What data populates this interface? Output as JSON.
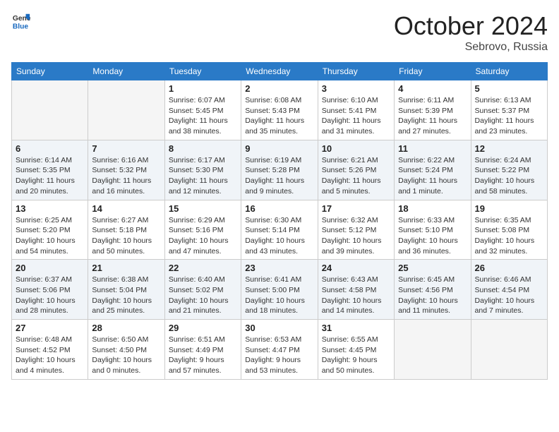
{
  "header": {
    "logo": {
      "general": "General",
      "blue": "Blue"
    },
    "month": "October 2024",
    "location": "Sebrovo, Russia"
  },
  "weekdays": [
    "Sunday",
    "Monday",
    "Tuesday",
    "Wednesday",
    "Thursday",
    "Friday",
    "Saturday"
  ],
  "weeks": [
    [
      {
        "day": "",
        "sunrise": "",
        "sunset": "",
        "daylight": "",
        "empty": true
      },
      {
        "day": "",
        "sunrise": "",
        "sunset": "",
        "daylight": "",
        "empty": true
      },
      {
        "day": "1",
        "sunrise": "Sunrise: 6:07 AM",
        "sunset": "Sunset: 5:45 PM",
        "daylight": "Daylight: 11 hours and 38 minutes.",
        "empty": false
      },
      {
        "day": "2",
        "sunrise": "Sunrise: 6:08 AM",
        "sunset": "Sunset: 5:43 PM",
        "daylight": "Daylight: 11 hours and 35 minutes.",
        "empty": false
      },
      {
        "day": "3",
        "sunrise": "Sunrise: 6:10 AM",
        "sunset": "Sunset: 5:41 PM",
        "daylight": "Daylight: 11 hours and 31 minutes.",
        "empty": false
      },
      {
        "day": "4",
        "sunrise": "Sunrise: 6:11 AM",
        "sunset": "Sunset: 5:39 PM",
        "daylight": "Daylight: 11 hours and 27 minutes.",
        "empty": false
      },
      {
        "day": "5",
        "sunrise": "Sunrise: 6:13 AM",
        "sunset": "Sunset: 5:37 PM",
        "daylight": "Daylight: 11 hours and 23 minutes.",
        "empty": false
      }
    ],
    [
      {
        "day": "6",
        "sunrise": "Sunrise: 6:14 AM",
        "sunset": "Sunset: 5:35 PM",
        "daylight": "Daylight: 11 hours and 20 minutes.",
        "empty": false
      },
      {
        "day": "7",
        "sunrise": "Sunrise: 6:16 AM",
        "sunset": "Sunset: 5:32 PM",
        "daylight": "Daylight: 11 hours and 16 minutes.",
        "empty": false
      },
      {
        "day": "8",
        "sunrise": "Sunrise: 6:17 AM",
        "sunset": "Sunset: 5:30 PM",
        "daylight": "Daylight: 11 hours and 12 minutes.",
        "empty": false
      },
      {
        "day": "9",
        "sunrise": "Sunrise: 6:19 AM",
        "sunset": "Sunset: 5:28 PM",
        "daylight": "Daylight: 11 hours and 9 minutes.",
        "empty": false
      },
      {
        "day": "10",
        "sunrise": "Sunrise: 6:21 AM",
        "sunset": "Sunset: 5:26 PM",
        "daylight": "Daylight: 11 hours and 5 minutes.",
        "empty": false
      },
      {
        "day": "11",
        "sunrise": "Sunrise: 6:22 AM",
        "sunset": "Sunset: 5:24 PM",
        "daylight": "Daylight: 11 hours and 1 minute.",
        "empty": false
      },
      {
        "day": "12",
        "sunrise": "Sunrise: 6:24 AM",
        "sunset": "Sunset: 5:22 PM",
        "daylight": "Daylight: 10 hours and 58 minutes.",
        "empty": false
      }
    ],
    [
      {
        "day": "13",
        "sunrise": "Sunrise: 6:25 AM",
        "sunset": "Sunset: 5:20 PM",
        "daylight": "Daylight: 10 hours and 54 minutes.",
        "empty": false
      },
      {
        "day": "14",
        "sunrise": "Sunrise: 6:27 AM",
        "sunset": "Sunset: 5:18 PM",
        "daylight": "Daylight: 10 hours and 50 minutes.",
        "empty": false
      },
      {
        "day": "15",
        "sunrise": "Sunrise: 6:29 AM",
        "sunset": "Sunset: 5:16 PM",
        "daylight": "Daylight: 10 hours and 47 minutes.",
        "empty": false
      },
      {
        "day": "16",
        "sunrise": "Sunrise: 6:30 AM",
        "sunset": "Sunset: 5:14 PM",
        "daylight": "Daylight: 10 hours and 43 minutes.",
        "empty": false
      },
      {
        "day": "17",
        "sunrise": "Sunrise: 6:32 AM",
        "sunset": "Sunset: 5:12 PM",
        "daylight": "Daylight: 10 hours and 39 minutes.",
        "empty": false
      },
      {
        "day": "18",
        "sunrise": "Sunrise: 6:33 AM",
        "sunset": "Sunset: 5:10 PM",
        "daylight": "Daylight: 10 hours and 36 minutes.",
        "empty": false
      },
      {
        "day": "19",
        "sunrise": "Sunrise: 6:35 AM",
        "sunset": "Sunset: 5:08 PM",
        "daylight": "Daylight: 10 hours and 32 minutes.",
        "empty": false
      }
    ],
    [
      {
        "day": "20",
        "sunrise": "Sunrise: 6:37 AM",
        "sunset": "Sunset: 5:06 PM",
        "daylight": "Daylight: 10 hours and 28 minutes.",
        "empty": false
      },
      {
        "day": "21",
        "sunrise": "Sunrise: 6:38 AM",
        "sunset": "Sunset: 5:04 PM",
        "daylight": "Daylight: 10 hours and 25 minutes.",
        "empty": false
      },
      {
        "day": "22",
        "sunrise": "Sunrise: 6:40 AM",
        "sunset": "Sunset: 5:02 PM",
        "daylight": "Daylight: 10 hours and 21 minutes.",
        "empty": false
      },
      {
        "day": "23",
        "sunrise": "Sunrise: 6:41 AM",
        "sunset": "Sunset: 5:00 PM",
        "daylight": "Daylight: 10 hours and 18 minutes.",
        "empty": false
      },
      {
        "day": "24",
        "sunrise": "Sunrise: 6:43 AM",
        "sunset": "Sunset: 4:58 PM",
        "daylight": "Daylight: 10 hours and 14 minutes.",
        "empty": false
      },
      {
        "day": "25",
        "sunrise": "Sunrise: 6:45 AM",
        "sunset": "Sunset: 4:56 PM",
        "daylight": "Daylight: 10 hours and 11 minutes.",
        "empty": false
      },
      {
        "day": "26",
        "sunrise": "Sunrise: 6:46 AM",
        "sunset": "Sunset: 4:54 PM",
        "daylight": "Daylight: 10 hours and 7 minutes.",
        "empty": false
      }
    ],
    [
      {
        "day": "27",
        "sunrise": "Sunrise: 6:48 AM",
        "sunset": "Sunset: 4:52 PM",
        "daylight": "Daylight: 10 hours and 4 minutes.",
        "empty": false
      },
      {
        "day": "28",
        "sunrise": "Sunrise: 6:50 AM",
        "sunset": "Sunset: 4:50 PM",
        "daylight": "Daylight: 10 hours and 0 minutes.",
        "empty": false
      },
      {
        "day": "29",
        "sunrise": "Sunrise: 6:51 AM",
        "sunset": "Sunset: 4:49 PM",
        "daylight": "Daylight: 9 hours and 57 minutes.",
        "empty": false
      },
      {
        "day": "30",
        "sunrise": "Sunrise: 6:53 AM",
        "sunset": "Sunset: 4:47 PM",
        "daylight": "Daylight: 9 hours and 53 minutes.",
        "empty": false
      },
      {
        "day": "31",
        "sunrise": "Sunrise: 6:55 AM",
        "sunset": "Sunset: 4:45 PM",
        "daylight": "Daylight: 9 hours and 50 minutes.",
        "empty": false
      },
      {
        "day": "",
        "sunrise": "",
        "sunset": "",
        "daylight": "",
        "empty": true
      },
      {
        "day": "",
        "sunrise": "",
        "sunset": "",
        "daylight": "",
        "empty": true
      }
    ]
  ]
}
